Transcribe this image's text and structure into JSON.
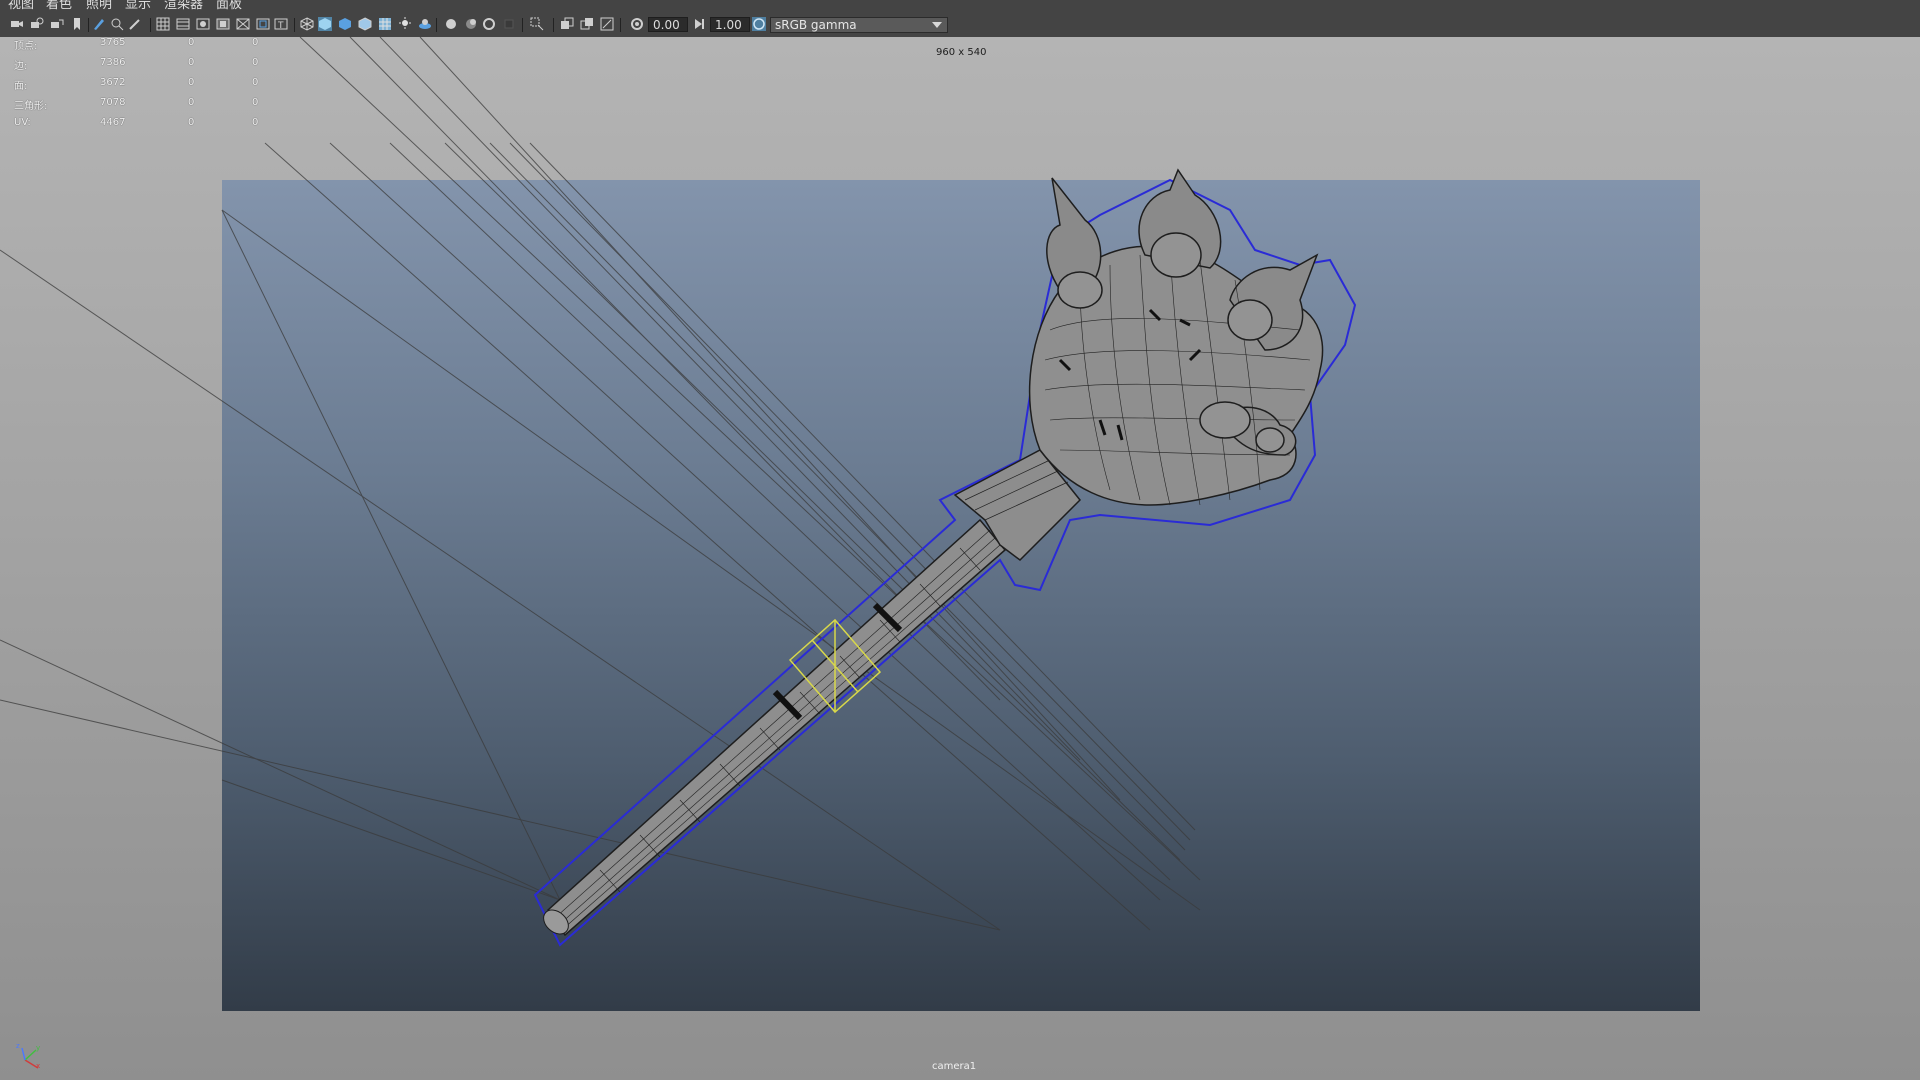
{
  "menu": [
    {
      "label": "视图"
    },
    {
      "label": "着色"
    },
    {
      "label": "照明"
    },
    {
      "label": "显示"
    },
    {
      "label": "渲染器"
    },
    {
      "label": "面板"
    }
  ],
  "toolbar": {
    "icons": [
      "camera-icon",
      "camera-attributes-icon",
      "bookmark-icon",
      "image-plane-icon",
      "grid-icon",
      "film-gate-icon",
      "resolution-gate-icon",
      "gate-mask-icon",
      "field-chart-icon",
      "safe-action-icon",
      "safe-title-icon",
      "wireframe-icon",
      "smooth-shade-icon",
      "default-material-icon",
      "textured-icon",
      "lights-icon",
      "shadows-icon",
      "screen-space-ao-icon",
      "motion-blur-icon",
      "anti-aliasing-icon",
      "isolate-select-icon",
      "xray-icon",
      "xray-joints-icon",
      "xray-components-icon",
      "exposure-icon",
      "gamma-icon",
      "view-transform-icon"
    ],
    "exposure_value": "0.00",
    "gamma_value": "1.00",
    "color_space": "sRGB gamma"
  },
  "hud": {
    "rows": [
      {
        "label": "顶点:",
        "a": "3765",
        "b": "0",
        "c": "0"
      },
      {
        "label": "边:",
        "a": "7386",
        "b": "0",
        "c": "0"
      },
      {
        "label": "面:",
        "a": "3672",
        "b": "0",
        "c": "0"
      },
      {
        "label": "三角形:",
        "a": "7078",
        "b": "0",
        "c": "0"
      },
      {
        "label": "UV:",
        "a": "4467",
        "b": "0",
        "c": "0"
      }
    ]
  },
  "viewport": {
    "resolution": "960 x 540",
    "camera": "camera1",
    "colors": {
      "selection_outline": "#2a2bd6",
      "locator": "#d8d84a",
      "model_fill": "#9a9a9a",
      "wire": "#202020"
    }
  }
}
